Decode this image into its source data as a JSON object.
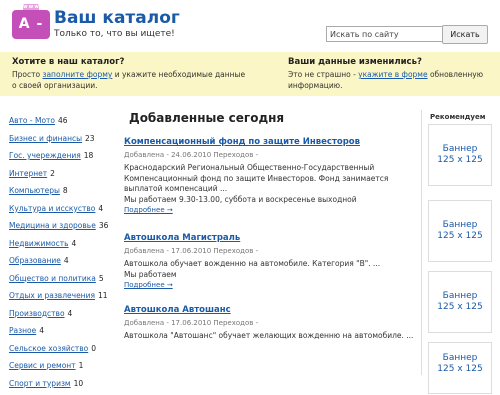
{
  "header": {
    "logo_text": "А - Я",
    "logo_badge": "www",
    "title": "Ваш каталог",
    "slogan": "Только то, что вы ищете!",
    "search_placeholder": "Искать по сайту",
    "search_button": "Искать"
  },
  "promo": {
    "left": {
      "title": "Хотите в наш каталог?",
      "text_before": "Просто ",
      "link": "заполните форму",
      "text_after": " и укажите необходимые данные о своей организации."
    },
    "right": {
      "title": "Ваши данные изменились?",
      "text_before": "Это не страшно - ",
      "link": "укажите в форме",
      "text_after": " обновленную информацию."
    }
  },
  "categories": [
    {
      "name": "Авто - Мото",
      "count": "46"
    },
    {
      "name": "Бизнес и финансы",
      "count": "23"
    },
    {
      "name": "Гос. учереждения",
      "count": "18"
    },
    {
      "name": "Интернет",
      "count": "2"
    },
    {
      "name": "Компьютеры",
      "count": "8"
    },
    {
      "name": "Культура и исскуство",
      "count": "4"
    },
    {
      "name": "Медицина и здоровье",
      "count": "36"
    },
    {
      "name": "Недвижимость",
      "count": "4"
    },
    {
      "name": "Образование",
      "count": "4"
    },
    {
      "name": "Общество и политика",
      "count": "5"
    },
    {
      "name": "Отдых и развлечения",
      "count": "11"
    },
    {
      "name": "Производство",
      "count": "4"
    },
    {
      "name": "Разное",
      "count": "4"
    },
    {
      "name": "Сельское хозяйство",
      "count": "0"
    },
    {
      "name": "Сервис и ремонт",
      "count": "1"
    },
    {
      "name": "Спорт и туризм",
      "count": "10"
    }
  ],
  "main": {
    "title": "Добавленные сегодня",
    "entries": [
      {
        "title": "Компенсационный фонд по защите Инвесторов",
        "meta": "Добавлена - 24.06.2010      Переходов -",
        "text": "Краснодарский Региональный Общественно-Государственный Компенсационный фонд по защите Инвесторов. Фонд занимается выплатой компенсаций ...",
        "text2": "Мы работаем 9.30-13.00, суббота и воскресенье выходной",
        "more": "Подробнее →"
      },
      {
        "title": "Автошкола Магистраль",
        "meta": "Добавлена - 17.06.2010      Переходов -",
        "text": "Автошкола обучает вожденню на автомобиле. Категория \"В\". ...",
        "text2": "Мы работаем",
        "more": "Подробнее →"
      },
      {
        "title": "Автошкола Автошанс",
        "meta": "Добавлена - 17.06.2010      Переходов -",
        "text": "Автошкола \"Автошанс\" обучает желающих вожденню на автомобиле. ...",
        "text2": "",
        "more": ""
      }
    ]
  },
  "sidebar_right": {
    "title": "Рекомендуем",
    "banners": [
      {
        "line1": "Баннер",
        "line2": "125 x 125"
      },
      {
        "line1": "Баннер",
        "line2": "125 x 125"
      },
      {
        "line1": "Баннер",
        "line2": "125 x 125"
      },
      {
        "line1": "Баннер",
        "line2": "125 x 125"
      }
    ]
  }
}
